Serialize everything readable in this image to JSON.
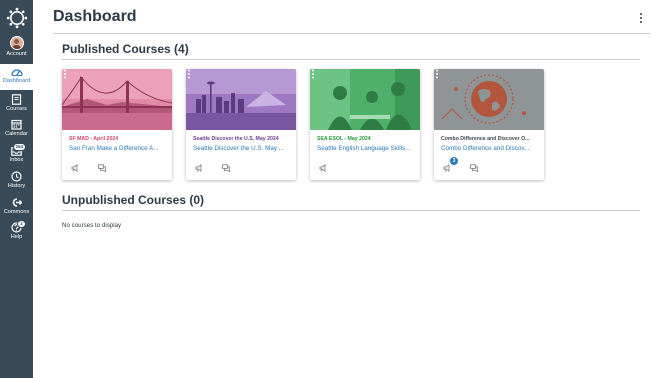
{
  "nav": {
    "account": "Account",
    "dashboard": "Dashboard",
    "courses": "Courses",
    "calendar": "Calendar",
    "inbox": "Inbox",
    "inbox_badge": "264",
    "history": "History",
    "commons": "Commons",
    "help": "Help",
    "help_badge": "1"
  },
  "header": {
    "title": "Dashboard"
  },
  "published": {
    "title": "Published Courses (4)",
    "cards": [
      {
        "code": "SF MAD - April 2024",
        "name": "San Fran Make a Difference A...",
        "code_color": "#d9406b"
      },
      {
        "code": "Seattle Discover the U.S. May 2024",
        "name": "Seattle Discover the U.S. May ...",
        "code_color": "#6d3c91"
      },
      {
        "code": "SEA ESOL - May 2024",
        "name": "Seattle English Language Skills...",
        "code_color": "#1f9b3c"
      },
      {
        "code": "Combo Difference and Discover O...",
        "name": "Combo Difference and Discov...",
        "code_color": "#3b4650",
        "badge": "3"
      }
    ]
  },
  "unpublished": {
    "title": "Unpublished Courses (0)",
    "empty": "No courses to display"
  }
}
